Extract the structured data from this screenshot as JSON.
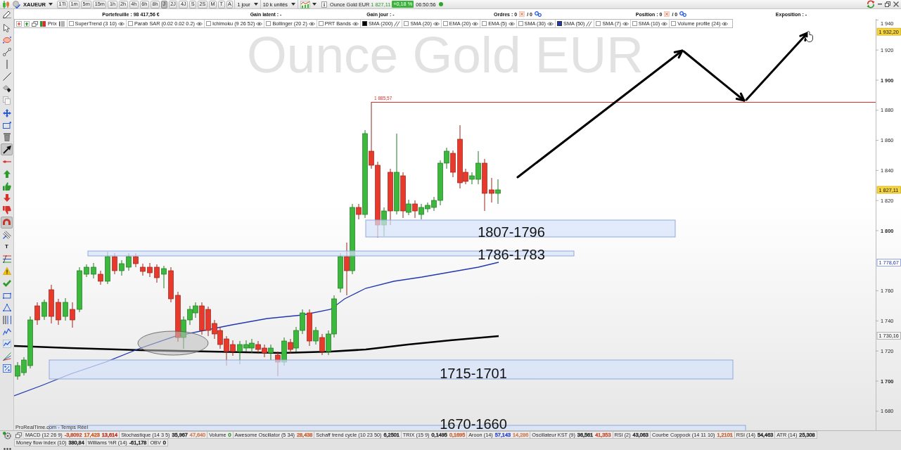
{
  "toolbar": {
    "symbol": "XAUEUR",
    "timeframes": [
      {
        "label": "1Ti",
        "selected": false
      },
      {
        "label": "1m",
        "selected": false
      },
      {
        "label": "5m",
        "selected": false
      },
      {
        "label": "15m",
        "selected": false
      },
      {
        "label": "1h",
        "selected": false
      },
      {
        "label": "2h",
        "selected": false
      },
      {
        "label": "4h",
        "selected": false
      },
      {
        "label": "6h",
        "selected": false
      },
      {
        "label": "8h",
        "selected": false
      },
      {
        "label": "J",
        "selected": true
      },
      {
        "label": "2J",
        "selected": false
      },
      {
        "label": "4J",
        "selected": false
      },
      {
        "label": "S",
        "selected": false
      },
      {
        "label": "2S",
        "selected": false
      },
      {
        "label": "M",
        "selected": false
      },
      {
        "label": "T",
        "selected": false
      },
      {
        "label": "A",
        "selected": false
      }
    ],
    "period": "1 jour",
    "quantity": "10 k unités",
    "instrument": "Ounce Gold EUR",
    "last_price": "1 827,11",
    "change": "+0,18 %",
    "time": "06:50:56",
    "live": true
  },
  "account": [
    {
      "kind": "text",
      "label": "Portefeuille : 98 417,56 €"
    },
    {
      "kind": "text",
      "label": "Gain latent : -"
    },
    {
      "kind": "text",
      "label": "Gain jour : -"
    },
    {
      "kind": "count",
      "label": "Ordres : 0",
      "total": "/ 0"
    },
    {
      "kind": "count",
      "label": "Position : 0",
      "total": "/ 0"
    },
    {
      "kind": "text",
      "label": "Exposition : -"
    }
  ],
  "legend": {
    "price_label": "Prix",
    "indicators": [
      {
        "label": "SuperTrend (3 10)",
        "checked": false
      },
      {
        "label": "Parab SAR (0.02 0.02 0.2)",
        "checked": false
      },
      {
        "label": "Ichimoku (9 26 52)",
        "checked": false
      },
      {
        "label": "Bollinger (20 2)",
        "checked": false
      },
      {
        "label": "PRT Bands",
        "checked": false
      },
      {
        "label": "SMA (200)",
        "checked": true,
        "color": "#000000"
      },
      {
        "label": "SMA (20)",
        "checked": false
      },
      {
        "label": "EMA (20)",
        "checked": false
      },
      {
        "label": "EMA (5)",
        "checked": false
      },
      {
        "label": "SMA (30)",
        "checked": false
      },
      {
        "label": "SMA (50)",
        "checked": true,
        "color": "#2338b0"
      },
      {
        "label": "SMA (7)",
        "checked": false
      },
      {
        "label": "SMA (10)",
        "checked": false
      },
      {
        "label": "Volume profile (24)",
        "checked": false
      }
    ]
  },
  "tools": [
    {
      "kind": "icon",
      "selected": false
    },
    {
      "kind": "icon",
      "selected": false
    },
    {
      "kind": "icon",
      "selected": false
    },
    {
      "kind": "icon",
      "selected": false
    },
    {
      "kind": "icon",
      "selected": false
    },
    {
      "kind": "icon",
      "selected": false
    },
    {
      "kind": "icon",
      "selected": false
    },
    {
      "kind": "icon",
      "selected": false
    },
    {
      "kind": "icon",
      "selected": false
    },
    {
      "kind": "icon",
      "selected": false
    },
    {
      "kind": "icon",
      "selected": true
    },
    {
      "kind": "icon",
      "selected": false
    },
    {
      "kind": "icon",
      "selected": false
    },
    {
      "kind": "icon",
      "selected": false
    },
    {
      "kind": "icon",
      "selected": false
    },
    {
      "kind": "icon",
      "selected": false
    },
    {
      "kind": "icon",
      "selected": true
    },
    {
      "kind": "icon",
      "selected": false
    },
    {
      "kind": "text",
      "label": "T",
      "selected": false
    },
    {
      "kind": "icon",
      "selected": false
    },
    {
      "kind": "icon",
      "selected": false
    },
    {
      "kind": "icon",
      "selected": false
    },
    {
      "kind": "icon",
      "selected": false
    },
    {
      "kind": "icon",
      "selected": false
    },
    {
      "kind": "icon",
      "selected": false
    },
    {
      "kind": "icon",
      "selected": false
    },
    {
      "kind": "icon",
      "selected": false
    },
    {
      "kind": "icon",
      "selected": false
    },
    {
      "kind": "icon",
      "selected": false
    }
  ],
  "chart": {
    "watermark": "Ounce Gold EUR",
    "resistance_label": "1 885,57",
    "zones": [
      {
        "label": "1807-1796"
      },
      {
        "label": "1786-1783"
      },
      {
        "label": "1715-1701"
      },
      {
        "label": "1670-1660"
      }
    ],
    "axis_ticks": [
      {
        "label": "1 940",
        "major": false
      },
      {
        "label": "1 920",
        "major": false
      },
      {
        "label": "1 900",
        "major": true
      },
      {
        "label": "1 880",
        "major": false
      },
      {
        "label": "1 860",
        "major": false
      },
      {
        "label": "1 840",
        "major": false
      },
      {
        "label": "1 820",
        "major": false
      },
      {
        "label": "1 800",
        "major": true
      },
      {
        "label": "1 760",
        "major": false
      },
      {
        "label": "1 740",
        "major": false
      },
      {
        "label": "1 720",
        "major": false
      },
      {
        "label": "1 700",
        "major": true
      },
      {
        "label": "1 680",
        "major": false
      }
    ],
    "price_tags": [
      {
        "text": "1 932,20",
        "kind": "highlight"
      },
      {
        "text": "1 827,11",
        "kind": "highlight"
      },
      {
        "text": "1 778,67",
        "kind": "indicator"
      },
      {
        "text": "1 730,16",
        "kind": "level"
      }
    ],
    "source": "ProRealTime.com - Temps Réel"
  },
  "indicator_rows": [
    [
      {
        "name": "MACD (12 26 9)",
        "values": [
          {
            "text": "-3,8092",
            "color": "#c8553a"
          },
          {
            "text": "17,423",
            "color": "#d2591e"
          },
          {
            "text": "13,614",
            "color": "#c0392b"
          }
        ]
      },
      {
        "name": "Stochastique (14 3 5)",
        "values": [
          {
            "text": "35,967",
            "color": "#333333"
          },
          {
            "text": "47,640",
            "color": "#d08a6a"
          }
        ]
      },
      {
        "name": "Volume",
        "values": [
          {
            "text": "0",
            "color": "#3a9a3a"
          }
        ]
      },
      {
        "name": "Awesome Oscillator (5 34)",
        "values": [
          {
            "text": "28,438",
            "color": "#c8693f"
          }
        ]
      },
      {
        "name": "Schaff trend cycle (10 23 50)",
        "values": [
          {
            "text": "6,2501",
            "color": "#333333"
          }
        ]
      },
      {
        "name": "TRIX (15 9)",
        "values": [
          {
            "text": "0,1495",
            "color": "#333333"
          },
          {
            "text": "0,1695",
            "color": "#c8693f"
          }
        ]
      },
      {
        "name": "Aroon (14)",
        "values": [
          {
            "text": "57,143",
            "color": "#3a50c8"
          },
          {
            "text": "14,286",
            "color": "#d08a6a"
          }
        ]
      },
      {
        "name": "Oscillateur KST (9)",
        "values": [
          {
            "text": "36,561",
            "color": "#333333"
          },
          {
            "text": "41,353",
            "color": "#c8553a"
          }
        ]
      },
      {
        "name": "RSI (2)",
        "values": [
          {
            "text": "43,063",
            "color": "#333333"
          }
        ]
      },
      {
        "name": "Courbe Coppock (14 11 10)",
        "values": [
          {
            "text": "1,2101",
            "color": "#c8693f"
          }
        ]
      },
      {
        "name": "RSI (14)",
        "values": [
          {
            "text": "54,463",
            "color": "#333333"
          }
        ]
      },
      {
        "name": "ATR (14)",
        "values": [
          {
            "text": "25,308",
            "color": "#333333"
          }
        ]
      }
    ],
    [
      {
        "name": "Money flow index (10)",
        "values": [
          {
            "text": "380,84",
            "color": "#333333"
          }
        ]
      },
      {
        "name": "Williams %R (14)",
        "values": [
          {
            "text": "-61,178",
            "color": "#333333"
          }
        ]
      },
      {
        "name": "OBV",
        "values": [
          {
            "text": "0",
            "color": "#333333"
          }
        ]
      }
    ]
  ]
}
